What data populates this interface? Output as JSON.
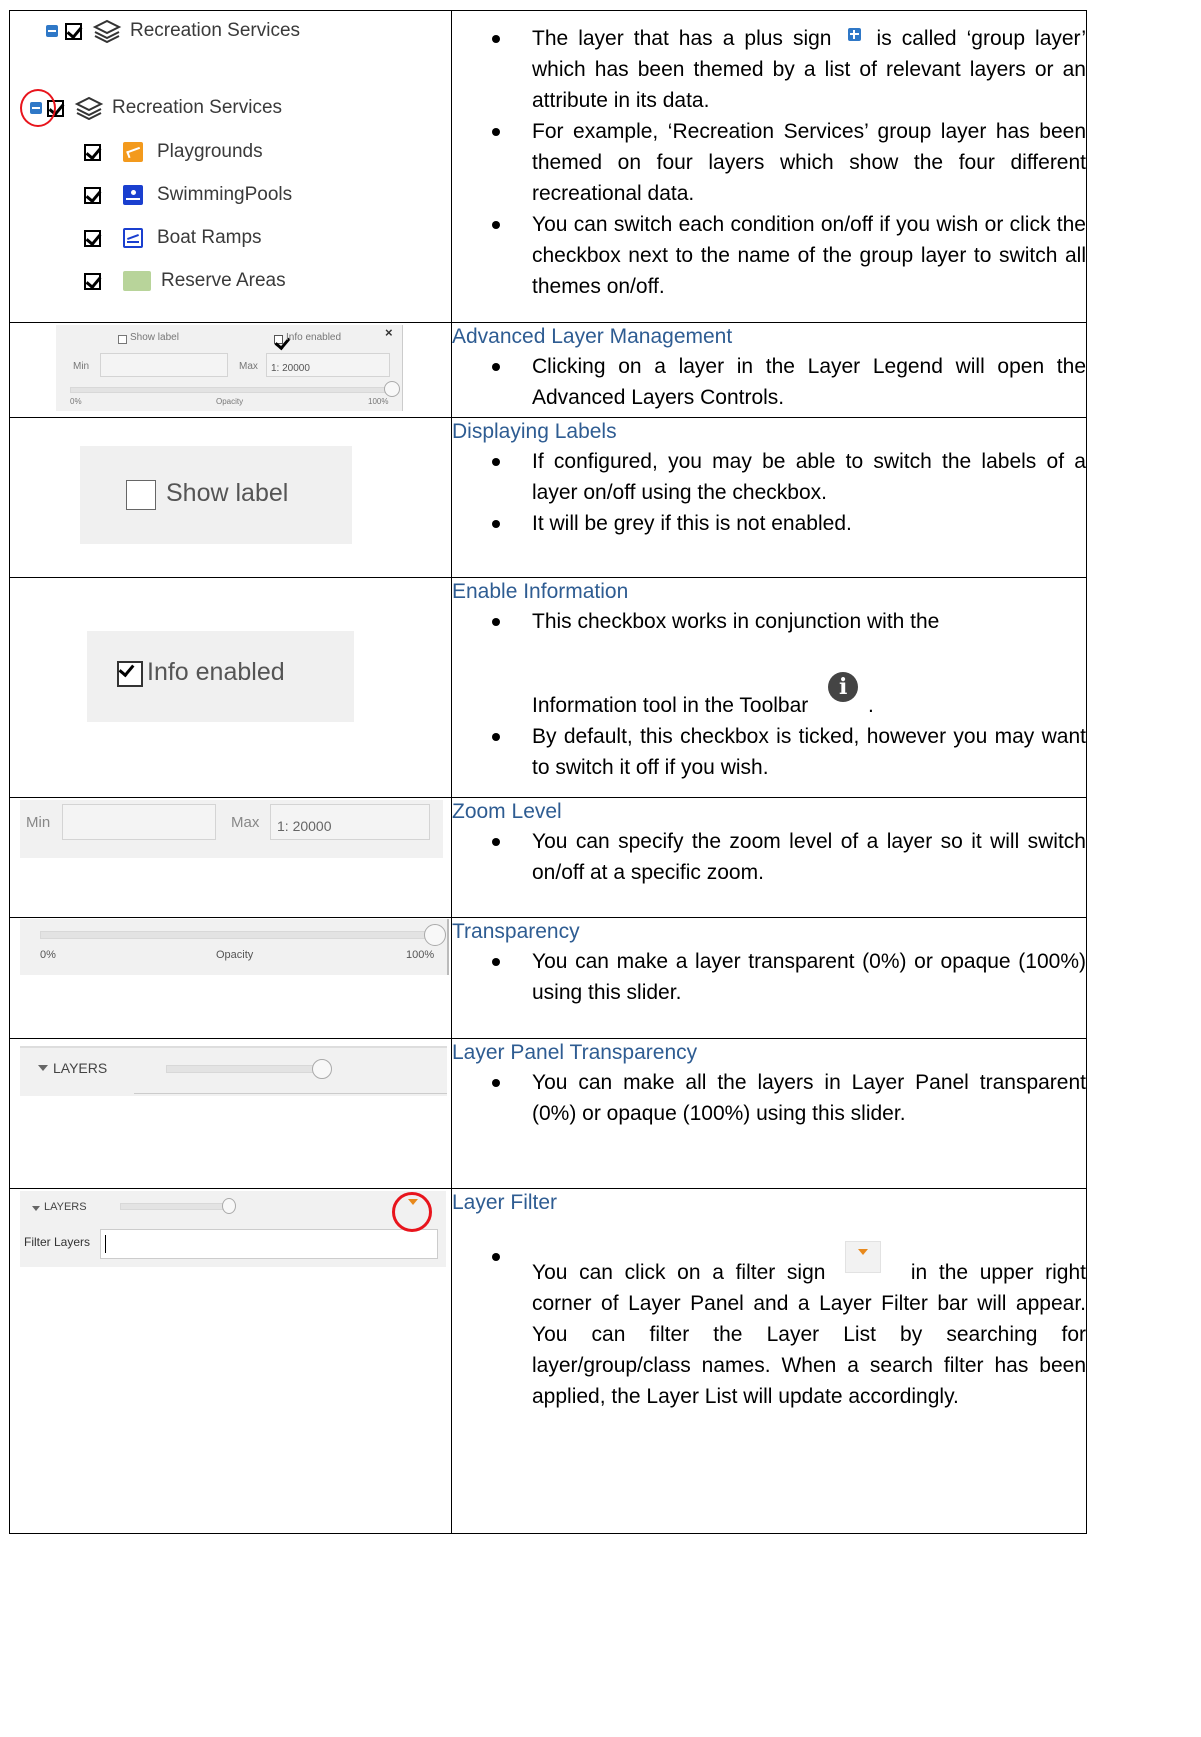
{
  "rows": [
    {
      "left": {
        "group_collapsed": "Recreation Services",
        "group_expanded": "Recreation Services",
        "items": [
          {
            "label": "Playgrounds",
            "icon": "playground-icon",
            "color": "#f39a1d"
          },
          {
            "label": "SwimmingPools",
            "icon": "swimming-pool-icon",
            "color": "#1a3fcf"
          },
          {
            "label": "Boat Ramps",
            "icon": "boat-ramp-icon",
            "color": "#1a3fcf"
          },
          {
            "label": "Reserve Areas",
            "icon": "reserve-area-swatch",
            "color": "#b8d49a"
          }
        ]
      },
      "heading": "",
      "bullets": [
        "The layer that has a plus sign",
        "is called ‘group layer’ which has been themed by a list of relevant layers or an attribute in its data.",
        "For example, ‘Recreation Services’ group layer has been themed on four layers which show the four different recreational data.",
        "You can switch each condition on/off if you wish or click the checkbox next to the name of the group layer to switch all themes on/off."
      ]
    },
    {
      "left": {
        "show_label": "Show label",
        "info_enabled": "Info enabled",
        "close": "×",
        "min": "Min",
        "max": "Max",
        "max_value": "1: 20000",
        "pct0": "0%",
        "opacity": "Opacity",
        "pct100": "100%"
      },
      "heading": "Advanced Layer Management",
      "bullets": [
        "Clicking on a layer in the Layer Legend will open the Advanced Layers Controls."
      ]
    },
    {
      "left": {
        "show_label": "Show label"
      },
      "heading": "Displaying Labels",
      "bullets": [
        "If configured, you may be able to switch the labels of a layer on/off using the checkbox.",
        "It will be grey if this is not enabled."
      ]
    },
    {
      "left": {
        "info_enabled": "Info enabled"
      },
      "heading": "Enable Information",
      "bullets": [
        "This checkbox works in conjunction with the",
        "Information tool in the Toolbar",
        ".",
        "By default, this checkbox is ticked, however you may want to switch it off if you wish."
      ]
    },
    {
      "left": {
        "min": "Min",
        "max": "Max",
        "max_value": "1: 20000"
      },
      "heading": "Zoom Level",
      "bullets": [
        "You can specify the zoom level of a layer so it will switch on/off at a specific zoom."
      ]
    },
    {
      "left": {
        "pct0": "0%",
        "opacity": "Opacity",
        "pct100": "100%"
      },
      "heading": "Transparency",
      "bullets": [
        "You can make a layer transparent (0%) or opaque (100%) using this slider."
      ]
    },
    {
      "left": {
        "layers": "LAYERS"
      },
      "heading": "Layer Panel Transparency",
      "bullets": [
        "You can make all the layers in Layer Panel transparent (0%) or opaque (100%) using this slider."
      ]
    },
    {
      "left": {
        "layers": "LAYERS",
        "filter_label": "Filter Layers"
      },
      "heading": "Layer Filter",
      "bullets": [
        "You can click on a filter sign",
        "in the upper right corner of Layer Panel and a Layer Filter bar will appear. You can filter the Layer List by searching for layer/group/class names. When a search filter has been applied, the Layer List will update accordingly."
      ]
    }
  ],
  "colors": {
    "heading": "#2e5c92",
    "highlight": "#e8141c",
    "filter": "#e8891c"
  }
}
